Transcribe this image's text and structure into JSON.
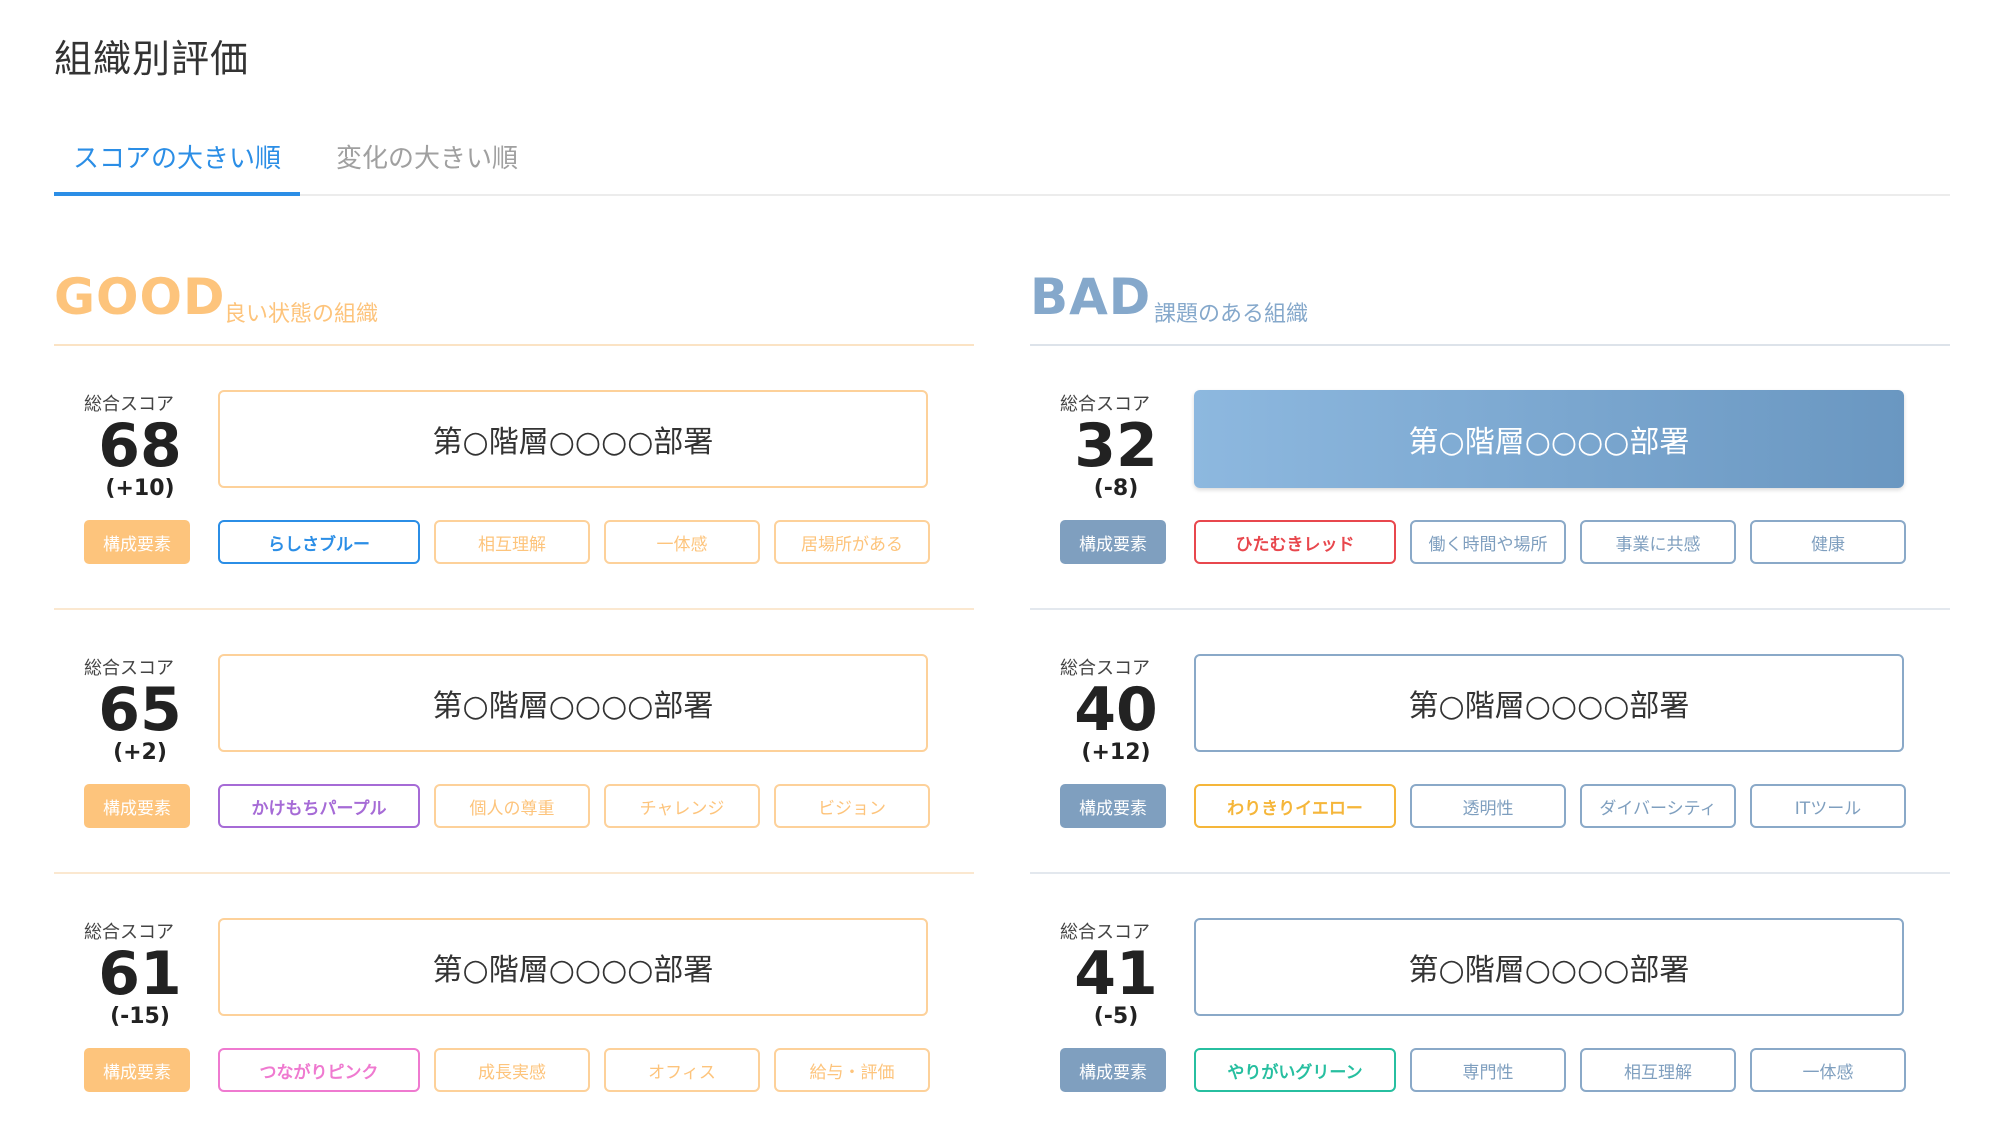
{
  "page": {
    "title": "組織別評価"
  },
  "tabs": [
    {
      "label": "スコアの大きい順",
      "active": true
    },
    {
      "label": "変化の大きい順",
      "active": false
    }
  ],
  "component_label": "構成要素",
  "score_label": "総合スコア",
  "good": {
    "title": "GOOD",
    "subtitle": "良い状態の組織",
    "accent": "#fdc47c",
    "cards": [
      {
        "score": "68",
        "delta": "(+10)",
        "dept": "第○階層○○○○部署",
        "primary_tag": {
          "label": "らしさブルー",
          "color": "#2b8ee6"
        },
        "tags": [
          "相互理解",
          "一体感",
          "居場所がある"
        ]
      },
      {
        "score": "65",
        "delta": "(+2)",
        "dept": "第○階層○○○○部署",
        "primary_tag": {
          "label": "かけもちパープル",
          "color": "#a66bd6"
        },
        "tags": [
          "個人の尊重",
          "チャレンジ",
          "ビジョン"
        ]
      },
      {
        "score": "61",
        "delta": "(-15)",
        "dept": "第○階層○○○○部署",
        "primary_tag": {
          "label": "つながりピンク",
          "color": "#ef7ad0"
        },
        "tags": [
          "成長実感",
          "オフィス",
          "給与・評価"
        ]
      }
    ]
  },
  "bad": {
    "title": "BAD",
    "subtitle": "課題のある組織",
    "accent": "#85a8cb",
    "cards": [
      {
        "score": "32",
        "delta": "(-8)",
        "dept": "第○階層○○○○部署",
        "highlight": true,
        "primary_tag": {
          "label": "ひたむきレッド",
          "color": "#e8474d"
        },
        "tags": [
          "働く時間や場所",
          "事業に共感",
          "健康"
        ]
      },
      {
        "score": "40",
        "delta": "(+12)",
        "dept": "第○階層○○○○部署",
        "highlight": false,
        "primary_tag": {
          "label": "わりきりイエロー",
          "color": "#f5b63a"
        },
        "tags": [
          "透明性",
          "ダイバーシティ",
          "ITツール"
        ]
      },
      {
        "score": "41",
        "delta": "(-5)",
        "dept": "第○階層○○○○部署",
        "highlight": false,
        "primary_tag": {
          "label": "やりがいグリーン",
          "color": "#27bfa0"
        },
        "tags": [
          "専門性",
          "相互理解",
          "一体感"
        ]
      }
    ]
  }
}
